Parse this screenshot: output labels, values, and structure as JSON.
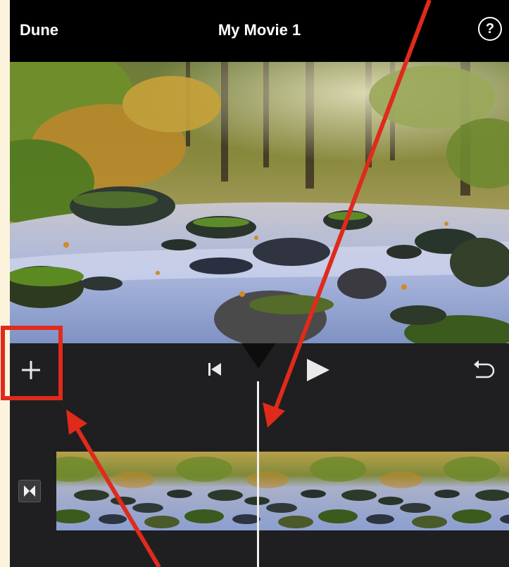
{
  "navbar": {
    "done_label": "Dune",
    "title": "My Movie 1",
    "help_label": "?"
  },
  "toolbar": {
    "add_icon": "plus-icon",
    "skip_back_icon": "skip-to-start-icon",
    "play_icon": "play-icon",
    "undo_icon": "undo-icon"
  },
  "timeline": {
    "transition_icon": "transition-icon",
    "clip": "river-stream-clip"
  },
  "annotations": {
    "arrow_color": "#e02a1b",
    "highlight_color": "#e02a1b"
  },
  "colors": {
    "navbar_bg": "#000000",
    "panel_bg": "#1f1f21",
    "page_bg": "#fbf3dc"
  }
}
